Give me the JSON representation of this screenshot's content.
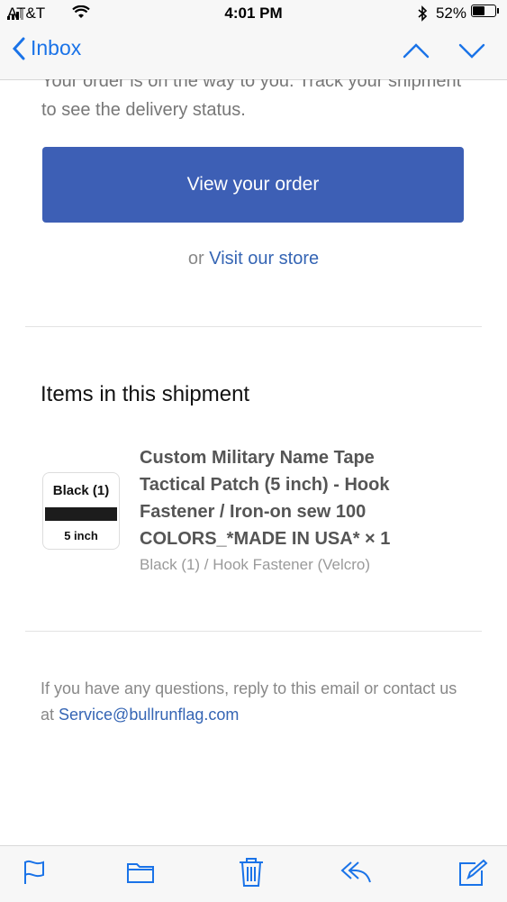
{
  "status_bar": {
    "carrier": "AT&T",
    "time": "4:01 PM",
    "battery": "52%"
  },
  "nav": {
    "back_label": "Inbox"
  },
  "email": {
    "intro_text": "Your order is on the way to you. Track your shipment to see the delivery status.",
    "cta_label": "View your order",
    "or_text": "or",
    "store_link": "Visit our store",
    "section_title": "Items in this shipment",
    "item": {
      "thumb_top": "Black (1)",
      "thumb_bottom": "5 inch",
      "title": "Custom Military Name Tape Tactical Patch (5 inch) - Hook Fastener / Iron-on sew 100 COLORS_*MADE IN USA* × 1",
      "variant": "Black (1) / Hook Fastener (Velcro)"
    },
    "footer_text": "If you have any questions, reply to this email or contact us at",
    "footer_email": "Service@bullrunflag.com"
  },
  "toolbar": {
    "icons": [
      "flag-icon",
      "folder-icon",
      "trash-icon",
      "reply-icon",
      "compose-icon"
    ]
  },
  "colors": {
    "accent": "#1a73e8",
    "button": "#3d5fb5",
    "link": "#3565b4"
  }
}
